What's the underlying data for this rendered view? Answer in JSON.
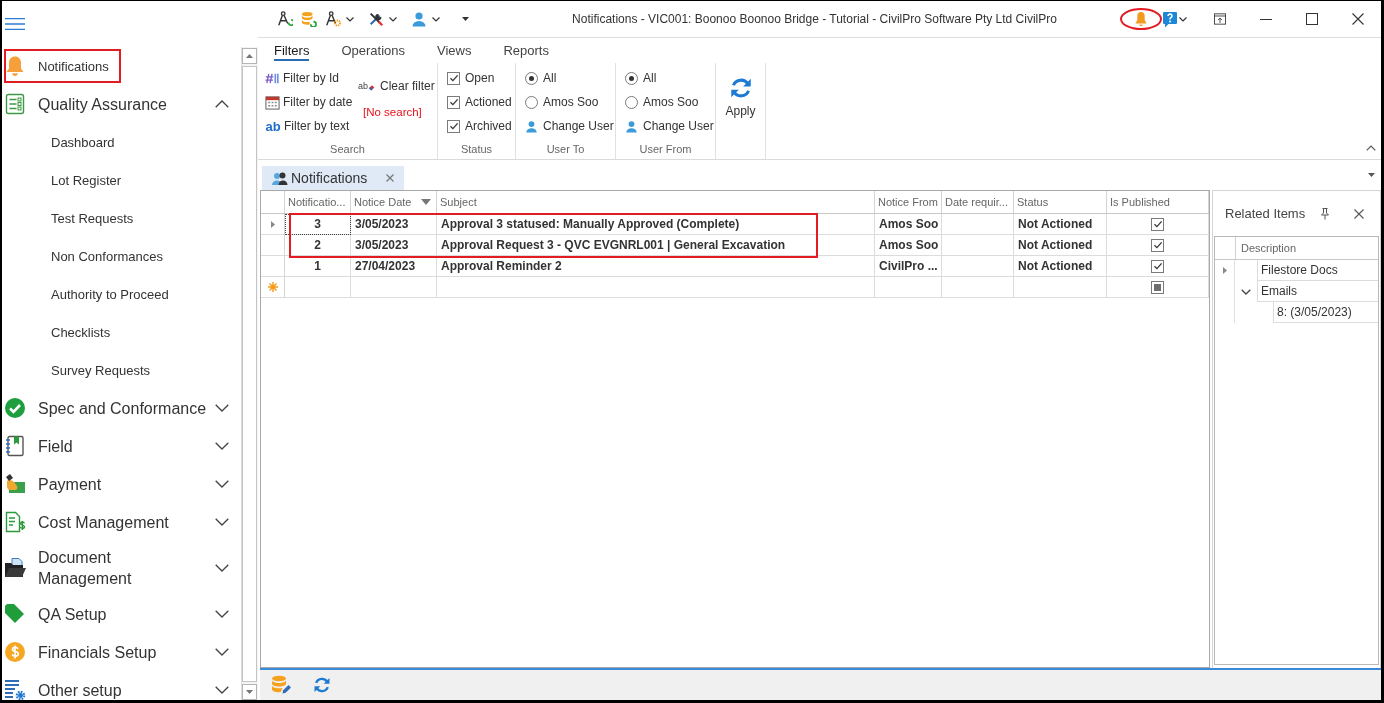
{
  "title_bar": {
    "title": "Notifications - VIC001: Boonoo Boonoo Bridge - Tutorial - CivilPro Software Pty Ltd CivilPro",
    "bell_highlighted": true
  },
  "sidebar": {
    "items": [
      {
        "kind": "link",
        "label": "Notifications",
        "highlighted": true
      },
      {
        "kind": "group",
        "label": "Quality Assurance",
        "highlighted": false,
        "expanded": true,
        "children": [
          {
            "label": "Dashboard"
          },
          {
            "label": "Lot Register"
          },
          {
            "label": "Test Requests"
          },
          {
            "label": "Non Conformances"
          },
          {
            "label": "Authority to Proceed"
          },
          {
            "label": "Checklists"
          },
          {
            "label": "Survey Requests"
          }
        ]
      },
      {
        "kind": "group",
        "label": "Spec and Conformance",
        "highlighted": false,
        "expanded": false
      },
      {
        "kind": "group",
        "label": "Field",
        "highlighted": false,
        "expanded": false
      },
      {
        "kind": "group",
        "label": "Payment",
        "highlighted": false,
        "expanded": false
      },
      {
        "kind": "group",
        "label": "Cost Management",
        "highlighted": false,
        "expanded": false
      },
      {
        "kind": "group",
        "label": "Document\nManagement",
        "highlighted": false,
        "expanded": false
      },
      {
        "kind": "group",
        "label": "QA Setup",
        "highlighted": false,
        "expanded": false
      },
      {
        "kind": "group",
        "label": "Financials Setup",
        "highlighted": false,
        "expanded": false
      },
      {
        "kind": "group",
        "label": "Other setup",
        "highlighted": false,
        "expanded": false
      }
    ]
  },
  "ribbon": {
    "tabs": [
      {
        "label": "Filters",
        "selected": true
      },
      {
        "label": "Operations",
        "selected": false
      },
      {
        "label": "Views",
        "selected": false
      },
      {
        "label": "Reports",
        "selected": false
      }
    ],
    "groups": [
      {
        "kind": "search",
        "label": "Search",
        "filters": [
          {
            "label": "Filter by Id"
          },
          {
            "label": "Filter by date"
          },
          {
            "label": "Filter by text",
            "glyph": "ab"
          }
        ],
        "clear": {
          "label": "Clear filter",
          "glyph": "ab"
        },
        "search_state": "[No search]"
      },
      {
        "kind": "checks",
        "label": "Status",
        "options": [
          {
            "label": "Open",
            "checked": true
          },
          {
            "label": "Actioned",
            "checked": true
          },
          {
            "label": "Archived",
            "checked": true
          }
        ]
      },
      {
        "kind": "radios",
        "label": "User To",
        "options": [
          {
            "label": "All",
            "selected": true
          },
          {
            "label": "Amos Soo",
            "selected": false
          }
        ],
        "change": "Change User"
      },
      {
        "kind": "radios",
        "label": "User From",
        "options": [
          {
            "label": "All",
            "selected": true
          },
          {
            "label": "Amos Soo",
            "selected": false
          }
        ],
        "change": "Change User"
      },
      {
        "kind": "action",
        "button": "Apply"
      }
    ]
  },
  "document_tabs": [
    {
      "label": "Notifications",
      "selected": true
    }
  ],
  "grid": {
    "columns": [
      {
        "label": "Notificatio...",
        "sorted": false
      },
      {
        "label": "Notice Date",
        "sorted": true
      },
      {
        "label": "Subject",
        "sorted": false
      },
      {
        "label": "Notice From",
        "sorted": false
      },
      {
        "label": "Date requir...",
        "sorted": false
      },
      {
        "label": "Status",
        "sorted": false
      },
      {
        "label": "Is Published",
        "sorted": false
      }
    ],
    "rows": [
      {
        "notification": "3",
        "notice_date": "3/05/2023",
        "subject": "Approval 3 statused: Manually Approved (Complete)",
        "notice_from": "Amos Soo",
        "status": "Not Actioned",
        "is_published": true,
        "current": true,
        "highlighted": true
      },
      {
        "notification": "2",
        "notice_date": "3/05/2023",
        "subject": "Approval Request 3 - QVC EVGNRL001 | General Excavation",
        "notice_from": "Amos Soo",
        "status": "Not Actioned",
        "is_published": true,
        "current": false,
        "highlighted": true
      },
      {
        "notification": "1",
        "notice_date": "27/04/2023",
        "subject": "Approval Reminder 2",
        "notice_from": "CivilPro ...",
        "status": "Not Actioned",
        "is_published": true,
        "current": false,
        "highlighted": false
      }
    ],
    "new_row": {
      "indeterminate": true
    }
  },
  "related_items": {
    "title": "Related Items",
    "column": "Description",
    "tree": [
      {
        "label": "Filestore Docs",
        "current": true
      },
      {
        "label": "Emails",
        "current": false,
        "expanded": true,
        "children": [
          {
            "label": "8: (3/05/2023)",
            "current": false
          }
        ]
      }
    ]
  }
}
